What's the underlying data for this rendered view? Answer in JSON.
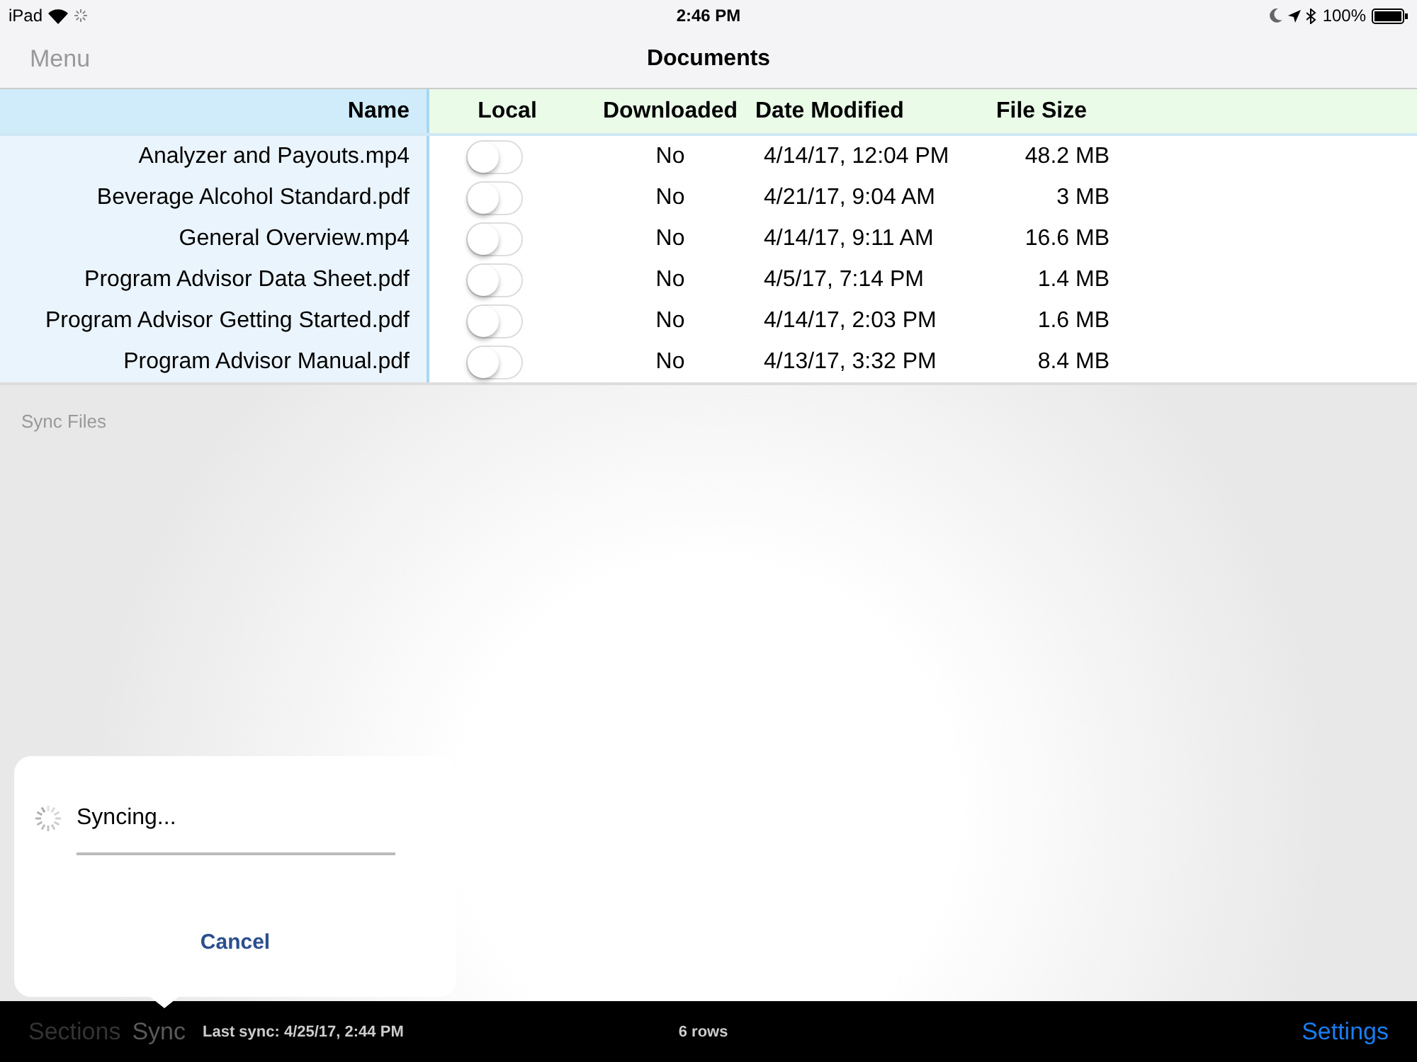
{
  "status_bar": {
    "device": "iPad",
    "time": "2:46 PM",
    "battery": "100%"
  },
  "nav": {
    "left": "Menu",
    "title": "Documents"
  },
  "table": {
    "columns": [
      "Name",
      "Local",
      "Downloaded",
      "Date Modified",
      "File Size"
    ],
    "rows": [
      {
        "name": "Analyzer and Payouts.mp4",
        "local": false,
        "downloaded": "No",
        "date": "4/14/17, 12:04 PM",
        "size": "48.2 MB"
      },
      {
        "name": "Beverage Alcohol Standard.pdf",
        "local": false,
        "downloaded": "No",
        "date": "4/21/17, 9:04 AM",
        "size": "3 MB"
      },
      {
        "name": "General Overview.mp4",
        "local": false,
        "downloaded": "No",
        "date": "4/14/17, 9:11 AM",
        "size": "16.6 MB"
      },
      {
        "name": "Program Advisor Data Sheet.pdf",
        "local": false,
        "downloaded": "No",
        "date": "4/5/17, 7:14 PM",
        "size": "1.4 MB"
      },
      {
        "name": "Program Advisor Getting Started.pdf",
        "local": false,
        "downloaded": "No",
        "date": "4/14/17, 2:03 PM",
        "size": "1.6 MB"
      },
      {
        "name": "Program Advisor Manual.pdf",
        "local": false,
        "downloaded": "No",
        "date": "4/13/17, 3:32 PM",
        "size": "8.4 MB"
      }
    ]
  },
  "section_label": "Sync Files",
  "popover": {
    "message": "Syncing...",
    "progress": {
      "level": 0
    },
    "button": "Cancel"
  },
  "bottom_bar": {
    "tabs": [
      {
        "label": "Sections",
        "selected": false
      },
      {
        "label": "Sync",
        "selected": true
      }
    ],
    "last_sync": "Last sync: 4/25/17, 2:44 PM",
    "row_count": "6 rows",
    "settings": "Settings"
  }
}
